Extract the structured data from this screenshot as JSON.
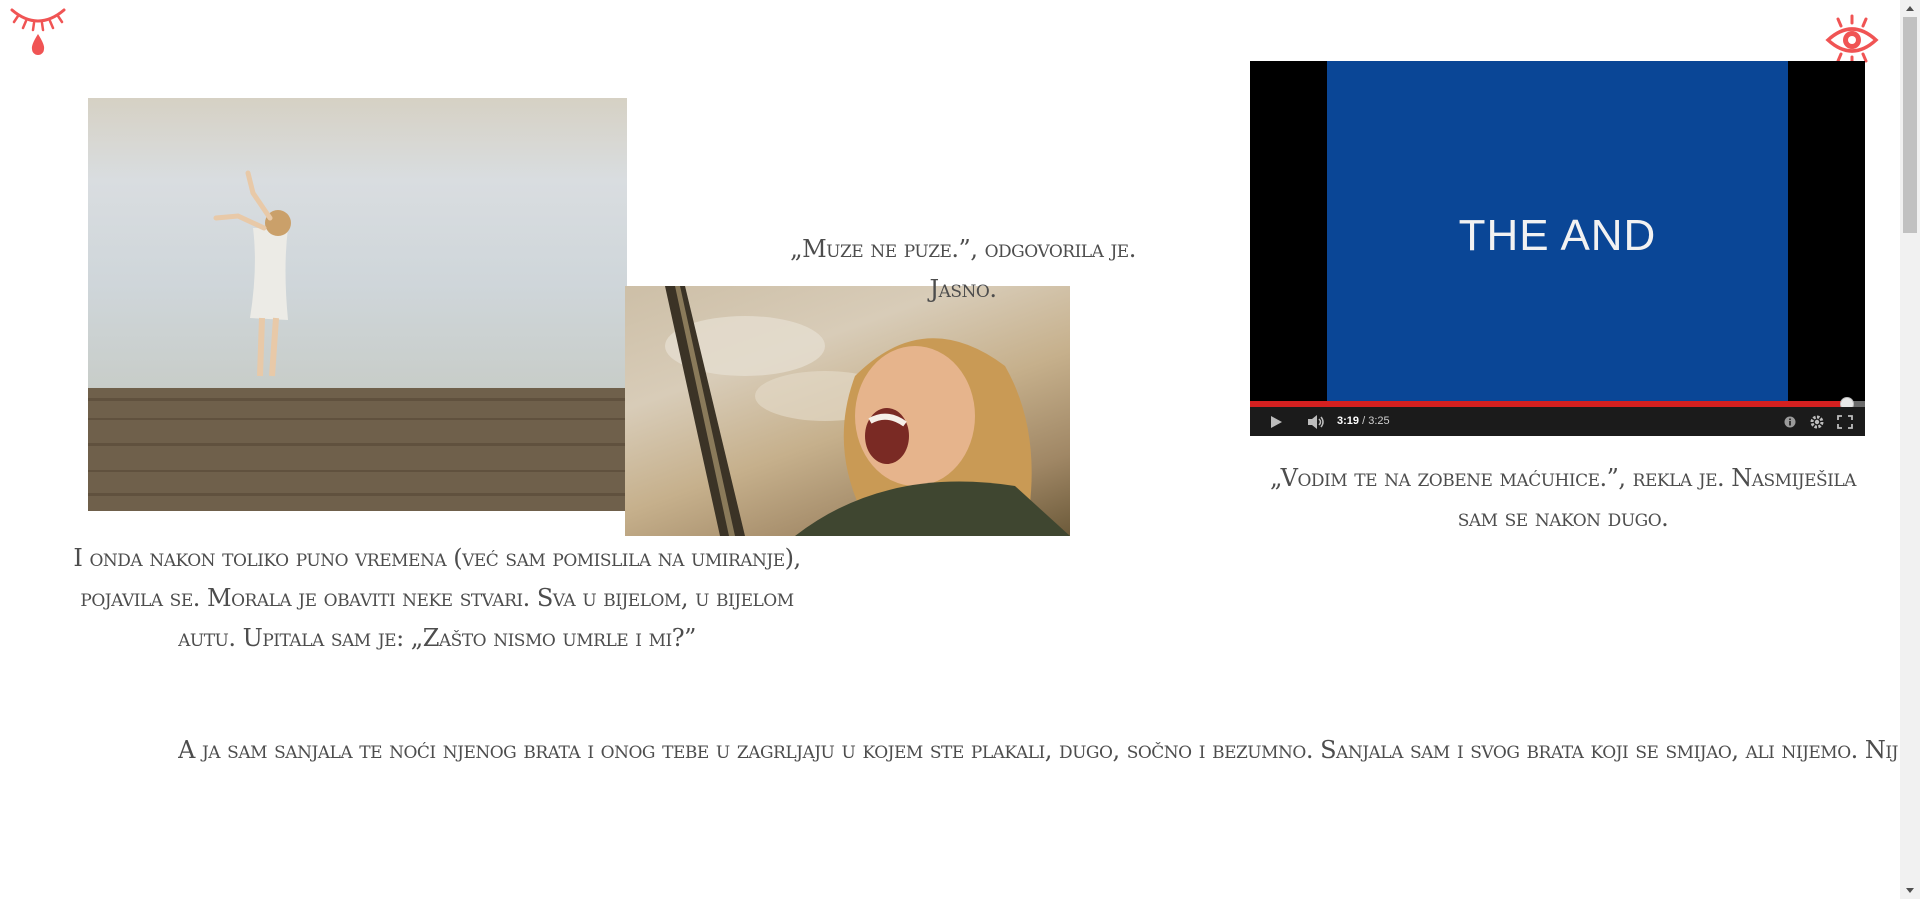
{
  "icons": {
    "left": "crying-eye-icon",
    "right": "open-eye-icon",
    "accent_color": "#f05454"
  },
  "images": {
    "field": "woman-in-white-dress-field-photo",
    "face": "laughing-woman-photo"
  },
  "captions": {
    "muze": "„Muze ne puze.”, odgovorila je. Jasno.",
    "video": "„Vodim te na zobene maćuhice.”, rekla je. Nasmiješila sam se nakon dugo.",
    "onda": "I onda nakon toliko puno vremena (već sam pomislila na umiranje), pojavila se. Morala je obaviti neke stvari. Sva u bijelom, u bijelom autu. Upitala sam je: „Zašto nismo umrle i mi?”",
    "bottom": "A ja sam sanjala te noći njenog brata i onog tebe u zagrljaju u kojem ste plakali, dugo, sočno i bezumno. Sanjala sam i svog brata koji se smijao, ali nijemo. Nije izgledao kao on, ali ono, kakvi su već snovi, fu"
  },
  "video": {
    "title": "THE AND",
    "current_time": "3:19",
    "duration": "3:25",
    "time_separator": " / ",
    "progress": 0.9707,
    "screen_color": "#0a4696",
    "progress_color": "#d42020"
  }
}
